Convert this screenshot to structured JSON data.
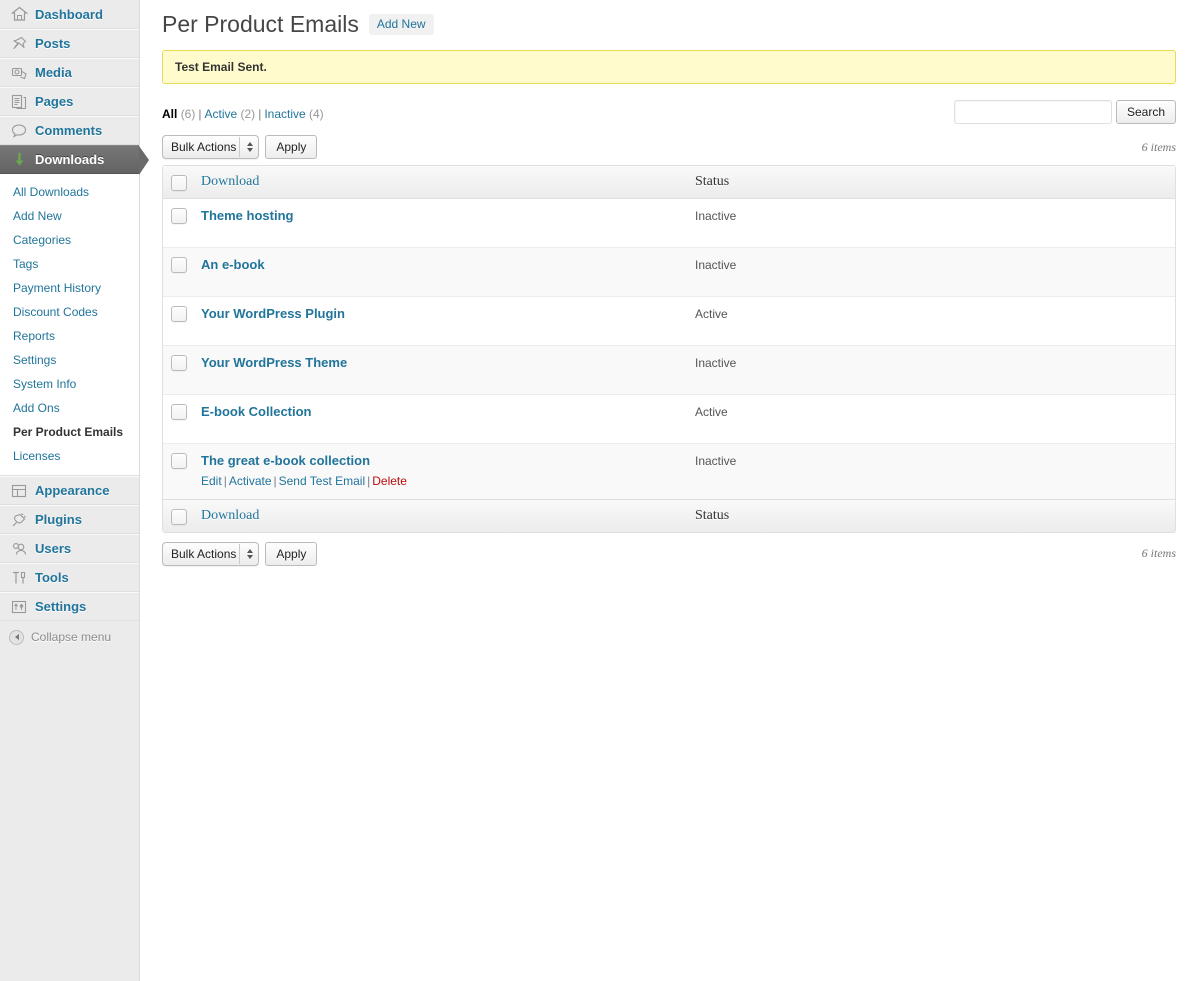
{
  "sidebar": {
    "items": [
      {
        "label": "Dashboard",
        "icon": "dashboard-icon",
        "current": false
      },
      {
        "label": "Posts",
        "icon": "pin-icon",
        "current": false
      },
      {
        "label": "Media",
        "icon": "camera-icon",
        "current": false
      },
      {
        "label": "Pages",
        "icon": "pages-icon",
        "current": false
      },
      {
        "label": "Comments",
        "icon": "comment-icon",
        "current": false
      },
      {
        "label": "Downloads",
        "icon": "download-arrow-icon",
        "current": true
      }
    ],
    "submenu": [
      {
        "label": "All Downloads",
        "current": false
      },
      {
        "label": "Add New",
        "current": false
      },
      {
        "label": "Categories",
        "current": false
      },
      {
        "label": "Tags",
        "current": false
      },
      {
        "label": "Payment History",
        "current": false
      },
      {
        "label": "Discount Codes",
        "current": false
      },
      {
        "label": "Reports",
        "current": false
      },
      {
        "label": "Settings",
        "current": false
      },
      {
        "label": "System Info",
        "current": false
      },
      {
        "label": "Add Ons",
        "current": false
      },
      {
        "label": "Per Product Emails",
        "current": true
      },
      {
        "label": "Licenses",
        "current": false
      }
    ],
    "items_after": [
      {
        "label": "Appearance",
        "icon": "appearance-icon",
        "current": false
      },
      {
        "label": "Plugins",
        "icon": "plug-icon",
        "current": false
      },
      {
        "label": "Users",
        "icon": "users-icon",
        "current": false
      },
      {
        "label": "Tools",
        "icon": "tools-icon",
        "current": false
      },
      {
        "label": "Settings",
        "icon": "settings-icon",
        "current": false
      }
    ],
    "collapse_label": "Collapse menu"
  },
  "header": {
    "title": "Per Product Emails",
    "add_new_label": "Add New"
  },
  "notice": {
    "text": "Test Email Sent.",
    "bg_color": "#fffbcc",
    "border_color": "#e6db55"
  },
  "filters": [
    {
      "label": "All",
      "count": "(6)",
      "current": true
    },
    {
      "label": "Active",
      "count": "(2)",
      "current": false
    },
    {
      "label": "Inactive",
      "count": "(4)",
      "current": false
    }
  ],
  "search": {
    "value": "",
    "placeholder": "",
    "button_label": "Search"
  },
  "tablenav": {
    "bulk_actions_label": "Bulk Actions",
    "apply_label": "Apply",
    "displaying_num": "6 items"
  },
  "table": {
    "columns": [
      "Download",
      "Status"
    ],
    "rows": [
      {
        "name": "Theme hosting",
        "status": "Inactive",
        "actions": []
      },
      {
        "name": "An e-book",
        "status": "Inactive",
        "actions": []
      },
      {
        "name": "Your WordPress Plugin",
        "status": "Active",
        "actions": []
      },
      {
        "name": "Your WordPress Theme",
        "status": "Inactive",
        "actions": []
      },
      {
        "name": "E-book Collection",
        "status": "Active",
        "actions": []
      },
      {
        "name": "The great e-book collection",
        "status": "Inactive",
        "actions": [
          {
            "label": "Edit",
            "kind": "edit"
          },
          {
            "label": "Activate",
            "kind": "activate"
          },
          {
            "label": "Send Test Email",
            "kind": "send-test-email"
          },
          {
            "label": "Delete",
            "kind": "delete"
          }
        ]
      }
    ]
  },
  "colors": {
    "link": "#21759b",
    "delete": "#bc0b0b",
    "sidebar_bg": "#ebebeb",
    "current_menu_bg": "#6d6d6d",
    "download_icon": "#6aa84f"
  }
}
